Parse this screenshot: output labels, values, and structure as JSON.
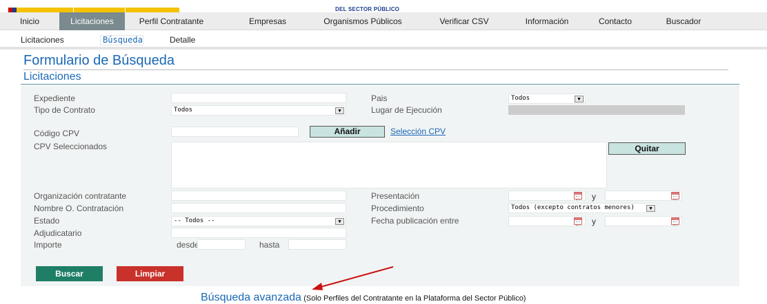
{
  "brand": "DEL SECTOR PÚBLICO",
  "nav": [
    "Inicio",
    "Licitaciones",
    "Perfil Contratante",
    "Empresas",
    "Organismos Públicos",
    "Verificar CSV",
    "Información",
    "Contacto",
    "Buscador"
  ],
  "subnav": [
    "Licitaciones",
    "Búsqueda",
    "Detalle"
  ],
  "title": "Formulario de Búsqueda",
  "subtitle": "Licitaciones",
  "form": {
    "expediente": "Expediente",
    "tipo_contrato": "Tipo de Contrato",
    "tipo_contrato_value": "Todos",
    "codigo_cpv": "Código CPV",
    "cpv_sel": "CPV Seleccionados",
    "org_contratante": "Organización contratante",
    "nombre_org": "Nombre O. Contratación",
    "estado": "Estado",
    "estado_value": "-- Todos --",
    "adjudicatario": "Adjudicatario",
    "importe": "Importe",
    "desde": "desde",
    "hasta": "hasta",
    "pais": "Pais",
    "pais_value": "Todos",
    "lugar": "Lugar de Ejecución",
    "presentacion": "Presentación",
    "procedimiento": "Procedimiento",
    "procedimiento_value": "Todos (excepto contratos menores)",
    "fecha_pub": "Fecha publicación entre",
    "y": "y",
    "anadir": "Añadir",
    "seleccion_cpv": "Selección CPV",
    "quitar": "Quitar"
  },
  "buttons": {
    "buscar": "Buscar",
    "limpiar": "Limpiar"
  },
  "advanced": {
    "link": "Búsqueda avanzada",
    "note": "(Solo Perfiles del Contratante en la Plataforma del Sector Público)"
  },
  "colors": {
    "accent": "#1a68b5",
    "nav_active": "#7a8a8e",
    "buscar": "#1e7f66",
    "limpiar": "#c8322b",
    "arrow": "#cc1111"
  }
}
